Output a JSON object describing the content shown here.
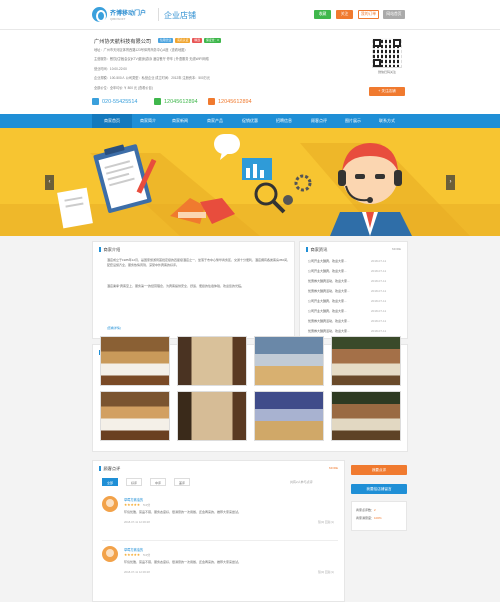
{
  "header": {
    "logo_text": "齐博移动门户",
    "logo_sub": "QIBOSOFT",
    "shop_name": "企业店铺",
    "buttons": [
      "收藏",
      "关注",
      "我的订单",
      "网站首页"
    ]
  },
  "company": {
    "name": "广州协天航科技有限公司",
    "tags": [
      "信用企业",
      "实名认证",
      "精选",
      "保证金：0"
    ],
    "tag_colors": [
      "#4aa3df",
      "#f0a52f",
      "#e85555",
      "#3fb74c"
    ],
    "address": "地址：广州市天河区体育西路123号体育商务中心A座（查看地图）",
    "services": "主营服务：餐饮|住宿|会议|KTV|健身|游泳 酒店餐厅 停车 | 外语服务 无线WIFI网络",
    "hours": "营业时间：10:00-22:00",
    "scale": "企业规模：100-500人  公司类型：私营企业  成立时间：2012年  注册资本：500万元",
    "price": "全部价位：全年均价 ￥ 800 元  (查看价目)",
    "phones": [
      "020-55425514",
      "12045612894",
      "12045612894"
    ],
    "phone_colors": [
      "#3aa0dc",
      "#3fb74c",
      "#f07a2f"
    ],
    "qr_caption": "微信扫码关注",
    "follow_button": "+ 关注店铺"
  },
  "nav": {
    "items": [
      "商家首页",
      "商家简介",
      "商家新闻",
      "商家产品",
      "促销优惠",
      "招聘信息",
      "顾客点评",
      "图片展示",
      "联系方式"
    ],
    "active_index": 0
  },
  "intro": {
    "title": "商家介绍",
    "paragraph1": "酒店成立于1985年12月，是国家旅游局首批定级的四星级酒店之一，坐落于市中心繁华商务区，交通十分便利，酒店拥有各类客房350间，配套设施齐全，服务热情周到，深受中外宾客的好评。",
    "paragraph2": "酒店秉承“宾客至上、服务第一”的经营理念，为宾客提供安全、舒适、便捷的住宿体验，欢迎您的光临。",
    "link": "[查看详情]"
  },
  "news": {
    "title": "商家资讯",
    "more": "MORE",
    "items": [
      {
        "text": "公司开业大酬宾，欢迎大家...",
        "date": "2018-07-11"
      },
      {
        "text": "公司开业大酬宾，欢迎大家...",
        "date": "2018-07-11"
      },
      {
        "text": "优惠券大酬宾活动，欢迎大家...",
        "date": "2018-07-11"
      },
      {
        "text": "优惠券大酬宾活动，欢迎大家...",
        "date": "2018-07-11"
      },
      {
        "text": "公司开业大酬宾，欢迎大家...",
        "date": "2018-07-11"
      },
      {
        "text": "公司开业大酬宾，欢迎大家...",
        "date": "2018-07-11"
      },
      {
        "text": "优惠券大酬宾活动，欢迎大家...",
        "date": "2018-07-11"
      },
      {
        "text": "优惠券大酬宾活动，欢迎大家...",
        "date": "2018-07-11"
      }
    ]
  },
  "photos": {
    "title": "商家相册",
    "more": "MORE"
  },
  "reviews": {
    "title": "顾客点评",
    "more": "MORE",
    "tabs": [
      "全部",
      "好评",
      "中评",
      "差评"
    ],
    "count_text": "共有2人参与点评",
    "list": [
      {
        "name": "草莓打酱油的",
        "stars": "★★★★★",
        "score": "5.0分",
        "text": "环境优雅，菜品不错，服务态度好，很满意的一次用餐，还会再来的，推荐大家来尝试。",
        "time": "2018-07-11  12:06:28",
        "likes": "赞(0)  回复(1)"
      },
      {
        "name": "草莓打酱油的",
        "stars": "★★★★★",
        "score": "5.0分",
        "text": "环境优雅，菜品不错，服务态度好，很满意的一次用餐，还会再来的，推荐大家来尝试。",
        "time": "2018-07-11  12:06:28",
        "likes": "赞(0)  回复(1)"
      }
    ]
  },
  "side": {
    "btn_review": "我要点评",
    "btn_message": "我要给店铺留言",
    "stats_title": "点评统计",
    "stat1": "商家点评数：",
    "stat1_val": "2",
    "stat2": "商家满意度：",
    "stat2_val": "100%"
  }
}
